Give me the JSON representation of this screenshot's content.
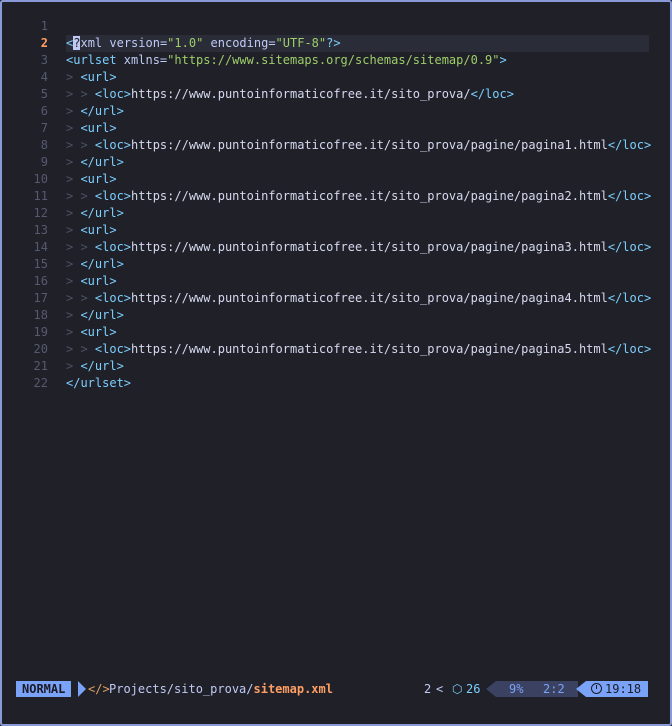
{
  "editor": {
    "current_line": 2,
    "lines": [
      {
        "n": "1",
        "tokens": []
      },
      {
        "n": "2",
        "tokens": [
          {
            "c": "tag",
            "t": "<"
          },
          {
            "c": "cursor",
            "t": "?"
          },
          {
            "c": "attr",
            "t": "xml version="
          },
          {
            "c": "str",
            "t": "\"1.0\""
          },
          {
            "c": "attr",
            "t": " encoding="
          },
          {
            "c": "str",
            "t": "\"UTF-8\""
          },
          {
            "c": "tag",
            "t": "?>"
          }
        ]
      },
      {
        "n": "3",
        "tokens": [
          {
            "c": "tag",
            "t": "<urlset"
          },
          {
            "c": "attr",
            "t": " xmlns="
          },
          {
            "c": "str",
            "t": "\"https://www.sitemaps.org/schemas/sitemap/0.9\""
          },
          {
            "c": "tag",
            "t": ">"
          }
        ]
      },
      {
        "n": "4",
        "tokens": [
          {
            "c": "ind",
            "t": "> "
          },
          {
            "c": "tag",
            "t": "<url>"
          }
        ]
      },
      {
        "n": "5",
        "tokens": [
          {
            "c": "ind",
            "t": "> > "
          },
          {
            "c": "tag",
            "t": "<loc>"
          },
          {
            "c": "url",
            "t": "https://www.puntoinformaticofree.it/sito_prova/"
          },
          {
            "c": "tag",
            "t": "</loc>"
          }
        ]
      },
      {
        "n": "6",
        "tokens": [
          {
            "c": "ind",
            "t": "> "
          },
          {
            "c": "tag",
            "t": "</url>"
          }
        ]
      },
      {
        "n": "7",
        "tokens": [
          {
            "c": "ind",
            "t": "> "
          },
          {
            "c": "tag",
            "t": "<url>"
          }
        ]
      },
      {
        "n": "8",
        "tokens": [
          {
            "c": "ind",
            "t": "> > "
          },
          {
            "c": "tag",
            "t": "<loc>"
          },
          {
            "c": "url",
            "t": "https://www.puntoinformaticofree.it/sito_prova/pagine/pagina1.html"
          },
          {
            "c": "tag",
            "t": "</loc>"
          }
        ]
      },
      {
        "n": "9",
        "tokens": [
          {
            "c": "ind",
            "t": "> "
          },
          {
            "c": "tag",
            "t": "</url>"
          }
        ]
      },
      {
        "n": "10",
        "tokens": [
          {
            "c": "ind",
            "t": "> "
          },
          {
            "c": "tag",
            "t": "<url>"
          }
        ]
      },
      {
        "n": "11",
        "tokens": [
          {
            "c": "ind",
            "t": "> > "
          },
          {
            "c": "tag",
            "t": "<loc>"
          },
          {
            "c": "url",
            "t": "https://www.puntoinformaticofree.it/sito_prova/pagine/pagina2.html"
          },
          {
            "c": "tag",
            "t": "</loc>"
          }
        ]
      },
      {
        "n": "12",
        "tokens": [
          {
            "c": "ind",
            "t": "> "
          },
          {
            "c": "tag",
            "t": "</url>"
          }
        ]
      },
      {
        "n": "13",
        "tokens": [
          {
            "c": "ind",
            "t": "> "
          },
          {
            "c": "tag",
            "t": "<url>"
          }
        ]
      },
      {
        "n": "14",
        "tokens": [
          {
            "c": "ind",
            "t": "> > "
          },
          {
            "c": "tag",
            "t": "<loc>"
          },
          {
            "c": "url",
            "t": "https://www.puntoinformaticofree.it/sito_prova/pagine/pagina3.html"
          },
          {
            "c": "tag",
            "t": "</loc>"
          }
        ]
      },
      {
        "n": "15",
        "tokens": [
          {
            "c": "ind",
            "t": "> "
          },
          {
            "c": "tag",
            "t": "</url>"
          }
        ]
      },
      {
        "n": "16",
        "tokens": [
          {
            "c": "ind",
            "t": "> "
          },
          {
            "c": "tag",
            "t": "<url>"
          }
        ]
      },
      {
        "n": "17",
        "tokens": [
          {
            "c": "ind",
            "t": "> > "
          },
          {
            "c": "tag",
            "t": "<loc>"
          },
          {
            "c": "url",
            "t": "https://www.puntoinformaticofree.it/sito_prova/pagine/pagina4.html"
          },
          {
            "c": "tag",
            "t": "</loc>"
          }
        ]
      },
      {
        "n": "18",
        "tokens": [
          {
            "c": "ind",
            "t": "> "
          },
          {
            "c": "tag",
            "t": "</url>"
          }
        ]
      },
      {
        "n": "19",
        "tokens": [
          {
            "c": "ind",
            "t": "> "
          },
          {
            "c": "tag",
            "t": "<url>"
          }
        ]
      },
      {
        "n": "20",
        "tokens": [
          {
            "c": "ind",
            "t": "> > "
          },
          {
            "c": "tag",
            "t": "<loc>"
          },
          {
            "c": "url",
            "t": "https://www.puntoinformaticofree.it/sito_prova/pagine/pagina5.html"
          },
          {
            "c": "tag",
            "t": "</loc>"
          }
        ]
      },
      {
        "n": "21",
        "tokens": [
          {
            "c": "ind",
            "t": "> "
          },
          {
            "c": "tag",
            "t": "</url>"
          }
        ]
      },
      {
        "n": "22",
        "tokens": [
          {
            "c": "tag",
            "t": "</urlset>"
          }
        ]
      }
    ]
  },
  "statusline": {
    "mode": "NORMAL",
    "file_icon": "</>",
    "path": "Projects/sito_prova/",
    "filename": "sitemap.xml",
    "diagnostics": "2",
    "diag_sep": "<",
    "package_icon": "⬡",
    "package_count": "26",
    "progress": "9%",
    "location": "2:2",
    "clock_icon": "clock-icon",
    "time": "19:18"
  },
  "colors": {
    "background": "#1f2028",
    "border": "#8a9ad8",
    "mode_bg": "#7aa2f7",
    "tag": "#7dcfff",
    "string": "#9ece6a",
    "current_line_number": "#ff9e64"
  }
}
